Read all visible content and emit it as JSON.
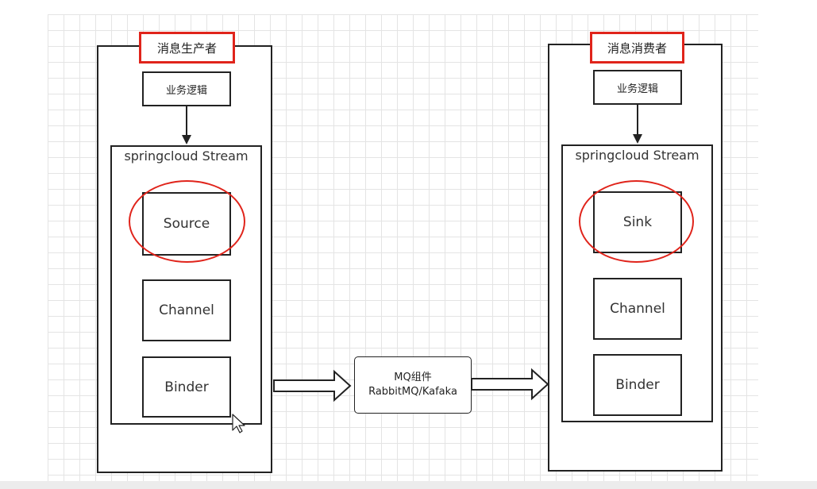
{
  "producer": {
    "title": "消息生产者",
    "business_logic": "业务逻辑",
    "stream_title": "springcloud Stream",
    "source": "Source",
    "channel": "Channel",
    "binder": "Binder"
  },
  "consumer": {
    "title": "消息消费者",
    "business_logic": "业务逻辑",
    "stream_title": "springcloud Stream",
    "sink": "Sink",
    "channel": "Channel",
    "binder": "Binder"
  },
  "mq": {
    "line1": "MQ组件",
    "line2": "RabbitMQ/Kafaka"
  },
  "colors": {
    "highlight": "#e0241b",
    "stroke": "#222222",
    "grid": "#e4e4e4"
  }
}
